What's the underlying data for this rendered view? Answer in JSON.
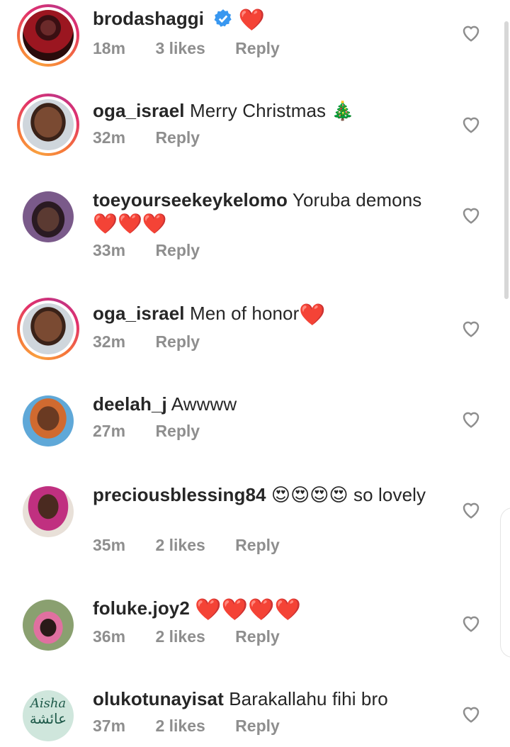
{
  "colors": {
    "heart_red": "#e0142a",
    "meta_grey": "#8e8e8e",
    "verified_blue": "#3897f0"
  },
  "comments": [
    {
      "username": "brodashaggi",
      "verified": true,
      "text": "",
      "emoji": "❤️",
      "time": "18m",
      "likes": "3 likes",
      "reply": "Reply"
    },
    {
      "username": "oga_israel",
      "text": "Merry Christmas",
      "emoji": "🎄",
      "time": "32m",
      "likes": "",
      "reply": "Reply"
    },
    {
      "username": "toeyourseekeykelomo",
      "text": "Yoruba demons",
      "emoji": "❤️❤️❤️",
      "time": "33m",
      "likes": "",
      "reply": "Reply"
    },
    {
      "username": "oga_israel",
      "text": "Men of honor",
      "emoji": "❤️",
      "time": "32m",
      "likes": "",
      "reply": "Reply"
    },
    {
      "username": "deelah_j",
      "text": "Awwww",
      "emoji": "",
      "time": "27m",
      "likes": "",
      "reply": "Reply"
    },
    {
      "username": "preciousblessing84",
      "text": "so lovely",
      "emoji": "😍😍😍😍",
      "time": "35m",
      "likes": "2 likes",
      "reply": "Reply"
    },
    {
      "username": "foluke.joy2",
      "text": "",
      "emoji": "❤️❤️❤️❤️",
      "time": "36m",
      "likes": "2 likes",
      "reply": "Reply"
    },
    {
      "username": "olukotunayisat",
      "text": "Barakallahu fihi bro",
      "emoji": "",
      "time": "37m",
      "likes": "2 likes",
      "reply": "Reply"
    }
  ],
  "avatar_text": {
    "aisha_latin": "Aisha",
    "aisha_arabic": "عائشة"
  }
}
